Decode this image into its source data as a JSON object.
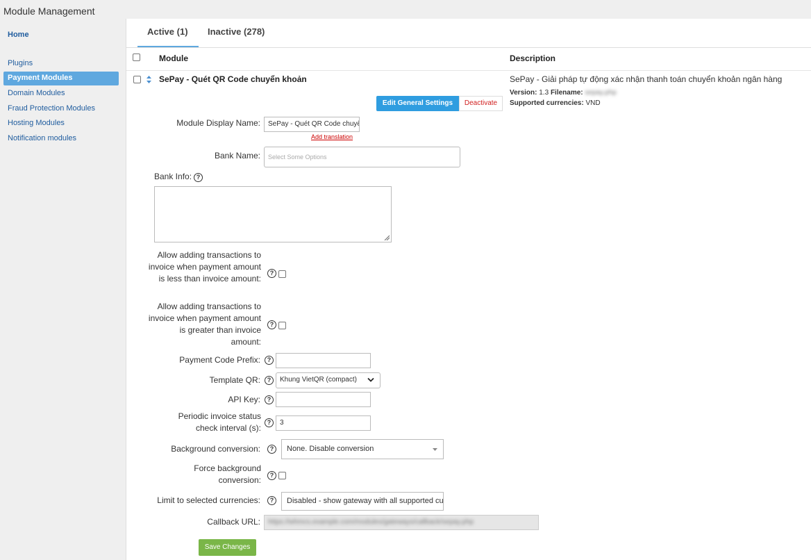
{
  "page_title": "Module Management",
  "sidebar": {
    "home": "Home",
    "items": [
      "Plugins",
      "Payment Modules",
      "Domain Modules",
      "Fraud Protection Modules",
      "Hosting Modules",
      "Notification modules"
    ]
  },
  "tabs": [
    "Active (1)",
    "Inactive (278)"
  ],
  "table": {
    "col_module": "Module",
    "col_description": "Description"
  },
  "module": {
    "name": "SePay - Quét QR Code chuyển khoản",
    "description": "SePay - Giải pháp tự động xác nhận thanh toán chuyển khoản ngân hàng",
    "version_label": "Version:",
    "version": "1.3",
    "filename_label": "Filename:",
    "filename": "sepay.php",
    "currencies_label": "Supported currencies:",
    "currencies": "VND",
    "edit_label": "Edit General Settings",
    "deactivate_label": "Deactivate"
  },
  "form": {
    "display_name_label": "Module Display Name:",
    "display_name_value": "SePay - Quét QR Code chuyển khoản",
    "add_translation": "Add translation",
    "bank_name_label": "Bank Name:",
    "bank_name_placeholder": "Select Some Options",
    "bank_info_label": "Bank Info:",
    "allow_less_label": "Allow adding transactions to invoice when payment amount is less than invoice amount:",
    "allow_greater_label": "Allow adding transactions to invoice when payment amount is greater than invoice amount:",
    "prefix_label": "Payment Code Prefix:",
    "template_label": "Template QR:",
    "template_value": "Khung VietQR (compact)",
    "api_key_label": "API Key:",
    "interval_label": "Periodic invoice status check interval (s):",
    "interval_value": "3",
    "bg_conversion_label": "Background conversion:",
    "bg_conversion_value": "None. Disable conversion",
    "force_bg_label": "Force background conversion:",
    "limit_label": "Limit to selected currencies:",
    "limit_value": "Disabled - show gateway with all supported currencies",
    "callback_label": "Callback URL:",
    "callback_value": "https://whmcs.example.com/modules/gateways/callback/sepay.php",
    "save_label": "Save Changes"
  },
  "colors": {
    "accent": "#5fa8df",
    "button_blue": "#2f9de0",
    "save_green": "#7ab648",
    "danger": "#d12020"
  },
  "icons": {
    "help": "question-circle-icon",
    "sort": "sort-icon",
    "dropdown": "chevron-down-icon"
  }
}
